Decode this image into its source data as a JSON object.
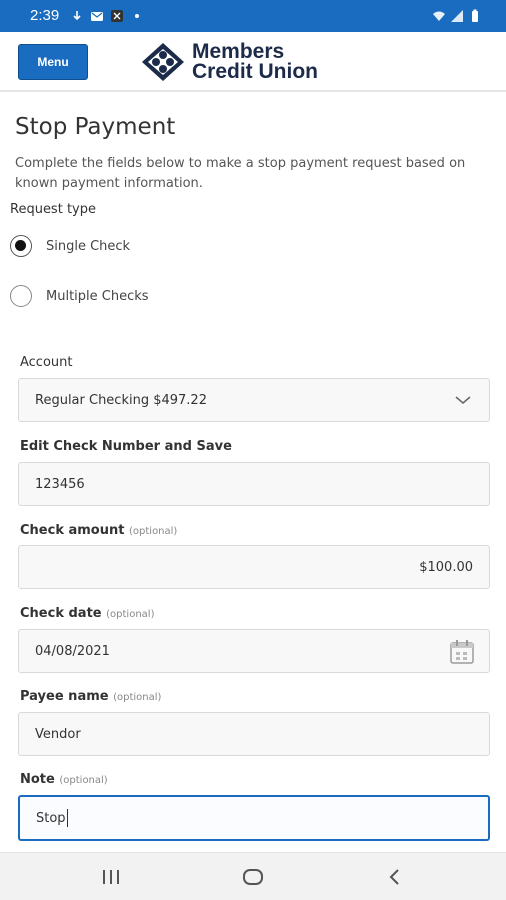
{
  "status_bar": {
    "time": "2:39",
    "left_icons": [
      "download-icon",
      "mail-icon",
      "app-icon",
      "dot-icon"
    ],
    "right_icons": [
      "wifi-icon",
      "signal-icon",
      "battery-icon"
    ],
    "color": "#1a6cc0"
  },
  "header": {
    "menu_label": "Menu",
    "brand_line1": "Members",
    "brand_line2": "Credit Union",
    "accent": "#1a6cc0"
  },
  "page": {
    "title": "Stop Payment",
    "description": "Complete the fields below to make a stop payment request based on known payment information."
  },
  "request_type": {
    "label": "Request type",
    "options": [
      {
        "label": "Single Check",
        "selected": true
      },
      {
        "label": "Multiple Checks",
        "selected": false
      }
    ]
  },
  "form": {
    "account": {
      "label": "Account",
      "value": "Regular Checking $497.22"
    },
    "check_number": {
      "label": "Edit Check Number and Save",
      "value": "123456"
    },
    "check_amount": {
      "label": "Check amount",
      "optional": "(optional)",
      "value": "$100.00"
    },
    "check_date": {
      "label": "Check date",
      "optional": "(optional)",
      "value": "04/08/2021"
    },
    "payee_name": {
      "label": "Payee name",
      "optional": "(optional)",
      "value": "Vendor"
    },
    "note": {
      "label": "Note",
      "optional": "(optional)",
      "value": "Stop"
    }
  },
  "nav_bar": {
    "buttons": [
      "recent-apps-icon",
      "home-icon",
      "back-icon"
    ]
  }
}
